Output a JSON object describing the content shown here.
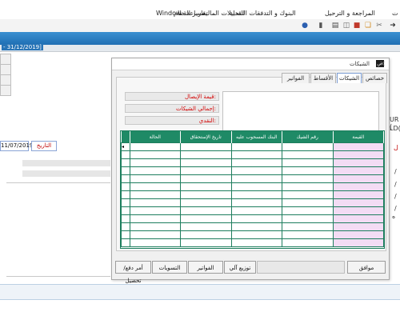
{
  "menubar": {
    "items": [
      "المراجعة و الترحيل",
      "البنوك و التدفقات النقدية",
      "التحليلات المالية",
      "تقارير النظام",
      "مساعدة",
      "Window"
    ],
    "fragment_right": "ت"
  },
  "topbar": {
    "date_label": "- 31/12/2019]"
  },
  "main_form": {
    "date_value": "11/07/2019",
    "date_caption": "التاريخ",
    "right_fragments": [
      "UR (",
      "LD(",
      "ل",
      "/",
      "/",
      "/",
      "/",
      "ه"
    ]
  },
  "dialog": {
    "title": "الشيكات",
    "tabs": {
      "properties": "خصائص",
      "cheques": "الشيكات",
      "installments": "الأقساط",
      "invoices": "الفواتير"
    },
    "info": {
      "receipt_value": "قيمة الإيصال:",
      "total_cheques": "إجمالي الشيكات:",
      "cash": "النقدي:"
    },
    "grid": {
      "headers": [
        "القيمة",
        "رقم الشيك",
        "البنك المسحوب عليه",
        "تاريخ الإستحقاق",
        "الحالة"
      ],
      "row_count": 13
    },
    "buttons": {
      "ok": "موافق",
      "distribute": "توزيع آلي",
      "invoices": "الفواتير",
      "settlements": "التسويات",
      "payment_order": "أمر دفع/تحصيل"
    }
  }
}
